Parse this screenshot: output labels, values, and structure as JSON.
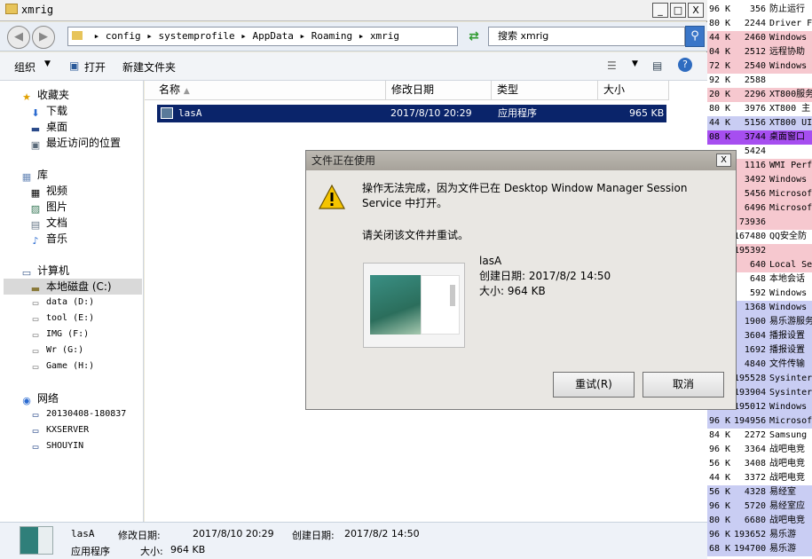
{
  "window": {
    "title": "xmrig",
    "min": "_",
    "max": "□",
    "close": "X"
  },
  "address": {
    "sep": "▸",
    "parts": [
      "config",
      "systemprofile",
      "AppData",
      "Roaming",
      "xmrig"
    ],
    "search_placeholder": "搜索 xmrig"
  },
  "toolbar": {
    "organize": "组织",
    "open": "打开",
    "new_folder": "新建文件夹"
  },
  "nav": {
    "favorites": {
      "title": "收藏夹",
      "items": [
        "下载",
        "桌面",
        "最近访问的位置"
      ]
    },
    "libraries": {
      "title": "库",
      "items": [
        "视频",
        "图片",
        "文档",
        "音乐"
      ]
    },
    "computer": {
      "title": "计算机",
      "drives": [
        "本地磁盘 (C:)",
        "data (D:)",
        "tool (E:)",
        "IMG (F:)",
        "Wr (G:)",
        "Game (H:)"
      ]
    },
    "network": {
      "title": "网络",
      "items": [
        "20130408-180837",
        "KXSERVER",
        "SHOUYIN"
      ]
    }
  },
  "columns": {
    "name": "名称",
    "modified": "修改日期",
    "type": "类型",
    "size": "大小"
  },
  "file": {
    "name": "lasA",
    "modified": "2017/8/10 20:29",
    "type": "应用程序",
    "size": "965 KB"
  },
  "status": {
    "name": "lasA",
    "modified_label": "修改日期:",
    "modified": "2017/8/10 20:29",
    "created_label": "创建日期:",
    "created": "2017/8/2 14:50",
    "type": "应用程序",
    "size_label": "大小:",
    "size": "964 KB"
  },
  "dialog": {
    "title": "文件正在使用",
    "message": "操作无法完成，因为文件已在 Desktop Window Manager Session Service 中打开。",
    "instruction": "请关闭该文件并重试。",
    "file_name": "lasA",
    "created": "创建日期: 2017/8/2 14:50",
    "size": "大小: 964 KB",
    "retry": "重试(R)",
    "cancel": "取消",
    "close": "X"
  },
  "processes": [
    {
      "k": "96 K",
      "v": "356",
      "n": "防止运行",
      "bg": "#ffffff"
    },
    {
      "k": "80 K",
      "v": "2244",
      "n": "Driver F",
      "bg": "#ffffff"
    },
    {
      "k": "44 K",
      "v": "2460",
      "n": "Windows",
      "bg": "#f6c8cf"
    },
    {
      "k": "04 K",
      "v": "2512",
      "n": "远程协助",
      "bg": "#f6c8cf"
    },
    {
      "k": "72 K",
      "v": "2540",
      "n": "Windows",
      "bg": "#f6c8cf"
    },
    {
      "k": "92 K",
      "v": "2588",
      "n": "",
      "bg": "#ffffff"
    },
    {
      "k": "20 K",
      "v": "2296",
      "n": "XT800服务",
      "bg": "#f6c8cf"
    },
    {
      "k": "80 K",
      "v": "3976",
      "n": "XT800 主",
      "bg": "#ffffff"
    },
    {
      "k": "44 K",
      "v": "5156",
      "n": "XT800 UI",
      "bg": "#c9cdf3"
    },
    {
      "k": "08 K",
      "v": "3744",
      "n": "桌面窗口",
      "bg": "#a64ef0"
    },
    {
      "k": "",
      "v": "5424",
      "n": "",
      "bg": "#ffffff"
    },
    {
      "k": "",
      "v": "1116",
      "n": "WMI Perf",
      "bg": "#f6c8cf"
    },
    {
      "k": "",
      "v": "3492",
      "n": "Windows",
      "bg": "#f6c8cf"
    },
    {
      "k": "",
      "v": "5456",
      "n": "Microsof",
      "bg": "#f6c8cf"
    },
    {
      "k": "",
      "v": "6496",
      "n": "Microsof",
      "bg": "#f6c8cf"
    },
    {
      "k": "",
      "v": "73936",
      "n": "",
      "bg": "#f6c8cf"
    },
    {
      "k": "",
      "v": "167480",
      "n": "QQ安全防",
      "bg": "#ffffff"
    },
    {
      "k": "",
      "v": "195392",
      "n": "",
      "bg": "#f6c8cf"
    },
    {
      "k": "",
      "v": "640",
      "n": "Local Se",
      "bg": "#f6c8cf"
    },
    {
      "k": "",
      "v": "648",
      "n": "本地会话",
      "bg": "#ffffff"
    },
    {
      "k": "",
      "v": "592",
      "n": "Windows",
      "bg": "#ffffff"
    },
    {
      "k": "",
      "v": "1368",
      "n": "Windows",
      "bg": "#c9cdf3"
    },
    {
      "k": "",
      "v": "1900",
      "n": "易乐游服务",
      "bg": "#c9cdf3"
    },
    {
      "k": "",
      "v": "3604",
      "n": "播报设置",
      "bg": "#c9cdf3"
    },
    {
      "k": "",
      "v": "1692",
      "n": "播报设置",
      "bg": "#c9cdf3"
    },
    {
      "k": "",
      "v": "4840",
      "n": "文件传输",
      "bg": "#c9cdf3"
    },
    {
      "k": "",
      "v": "195528",
      "n": "Sysinter",
      "bg": "#c9cdf3"
    },
    {
      "k": "",
      "v": "193904",
      "n": "Sysinter",
      "bg": "#c9cdf3"
    },
    {
      "k": "",
      "v": "195012",
      "n": "Windows",
      "bg": "#c9cdf3"
    },
    {
      "k": "96 K",
      "v": "194956",
      "n": "Microsof",
      "bg": "#c9cdf3"
    },
    {
      "k": "84 K",
      "v": "2272",
      "n": "Samsung",
      "bg": "#ffffff"
    },
    {
      "k": "96 K",
      "v": "3364",
      "n": "战吧电竞",
      "bg": "#ffffff"
    },
    {
      "k": "56 K",
      "v": "3408",
      "n": "战吧电竞",
      "bg": "#ffffff"
    },
    {
      "k": "44 K",
      "v": "3372",
      "n": "战吧电竞",
      "bg": "#ffffff"
    },
    {
      "k": "56 K",
      "v": "4328",
      "n": "易经室",
      "bg": "#c9cdf3"
    },
    {
      "k": "96 K",
      "v": "5720",
      "n": "易经室应",
      "bg": "#c9cdf3"
    },
    {
      "k": "80 K",
      "v": "6680",
      "n": "战吧电竞",
      "bg": "#c9cdf3"
    },
    {
      "k": "96 K",
      "v": "193652",
      "n": "易乐游",
      "bg": "#c9cdf3"
    },
    {
      "k": "68 K",
      "v": "194700",
      "n": "易乐游",
      "bg": "#c9cdf3"
    }
  ]
}
